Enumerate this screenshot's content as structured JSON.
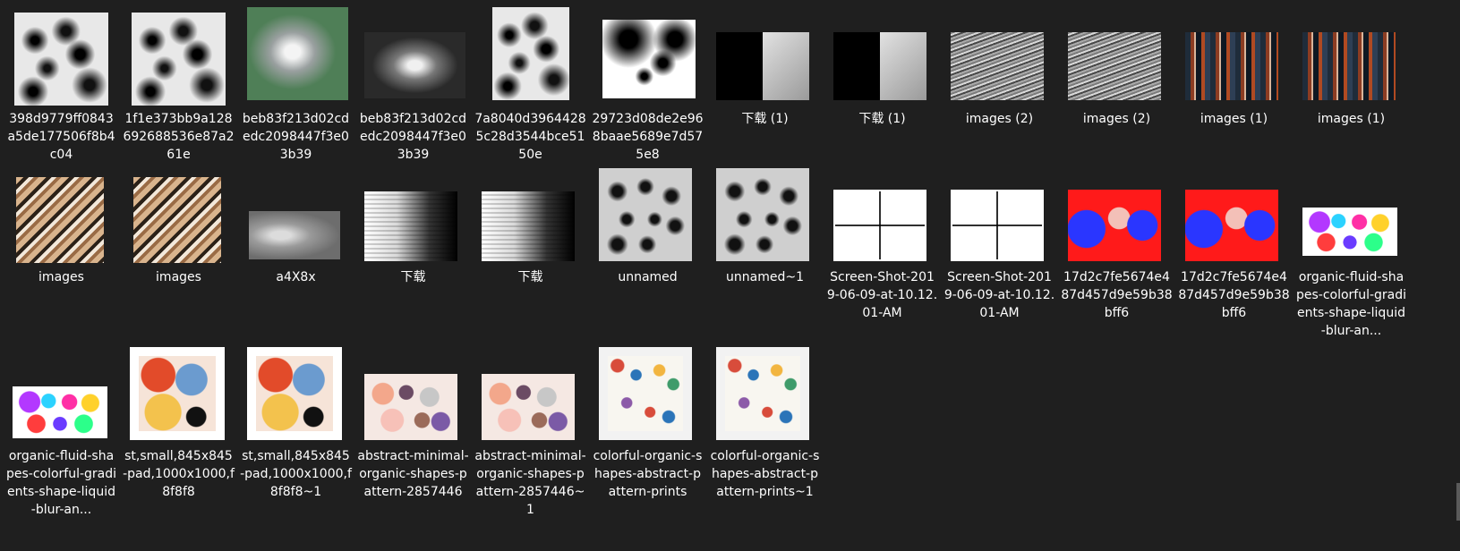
{
  "explorer": {
    "items": [
      {
        "label": "398d9779ff0843a5de177506f8b4c04",
        "icon": "thumbnail-image-icon"
      },
      {
        "label": "1f1e373bb9a128692688536e87a261e",
        "icon": "thumbnail-image-icon"
      },
      {
        "label": "beb83f213d02cdedc2098447f3e03b39",
        "icon": "thumbnail-image-icon"
      },
      {
        "label": "beb83f213d02cdedc2098447f3e03b39",
        "icon": "thumbnail-image-icon"
      },
      {
        "label": "7a8040d39644285c28d3544bce5150e",
        "icon": "thumbnail-image-icon"
      },
      {
        "label": "29723d08de2e968baae5689e7d575e8",
        "icon": "thumbnail-image-icon"
      },
      {
        "label": "下载 (1)",
        "icon": "thumbnail-image-icon"
      },
      {
        "label": "下载 (1)",
        "icon": "thumbnail-image-icon"
      },
      {
        "label": "images (2)",
        "icon": "thumbnail-image-icon"
      },
      {
        "label": "images (2)",
        "icon": "thumbnail-image-icon"
      },
      {
        "label": "images (1)",
        "icon": "thumbnail-image-icon"
      },
      {
        "label": "images (1)",
        "icon": "thumbnail-image-icon"
      },
      {
        "label": "images",
        "icon": "thumbnail-image-icon"
      },
      {
        "label": "images",
        "icon": "thumbnail-image-icon"
      },
      {
        "label": "a4X8x",
        "icon": "thumbnail-image-icon"
      },
      {
        "label": "下载",
        "icon": "thumbnail-image-icon"
      },
      {
        "label": "下载",
        "icon": "thumbnail-image-icon"
      },
      {
        "label": "unnamed",
        "icon": "thumbnail-image-icon"
      },
      {
        "label": "unnamed~1",
        "icon": "thumbnail-image-icon"
      },
      {
        "label": "Screen-Shot-2019-06-09-at-10.12.01-AM",
        "icon": "thumbnail-image-icon"
      },
      {
        "label": "Screen-Shot-2019-06-09-at-10.12.01-AM",
        "icon": "thumbnail-image-icon"
      },
      {
        "label": "17d2c7fe5674e487d457d9e59b38bff6",
        "icon": "thumbnail-image-icon"
      },
      {
        "label": "17d2c7fe5674e487d457d9e59b38bff6",
        "icon": "thumbnail-image-icon"
      },
      {
        "label": "organic-fluid-shapes-colorful-gradients-shape-liquid-blur-an...",
        "icon": "thumbnail-image-icon"
      },
      {
        "label": "organic-fluid-shapes-colorful-gradients-shape-liquid-blur-an...",
        "icon": "thumbnail-image-icon"
      },
      {
        "label": "st,small,845x845-pad,1000x1000,f8f8f8",
        "icon": "thumbnail-image-icon"
      },
      {
        "label": "st,small,845x845-pad,1000x1000,f8f8f8~1",
        "icon": "thumbnail-image-icon"
      },
      {
        "label": "abstract-minimal-organic-shapes-pattern-2857446",
        "icon": "thumbnail-image-icon"
      },
      {
        "label": "abstract-minimal-organic-shapes-pattern-2857446~1",
        "icon": "thumbnail-image-icon"
      },
      {
        "label": "colorful-organic-shapes-abstract-pattern-prints",
        "icon": "thumbnail-image-icon"
      },
      {
        "label": "colorful-organic-shapes-abstract-pattern-prints~1",
        "icon": "thumbnail-image-icon"
      }
    ]
  },
  "footer": {
    "bottom_text": ""
  }
}
